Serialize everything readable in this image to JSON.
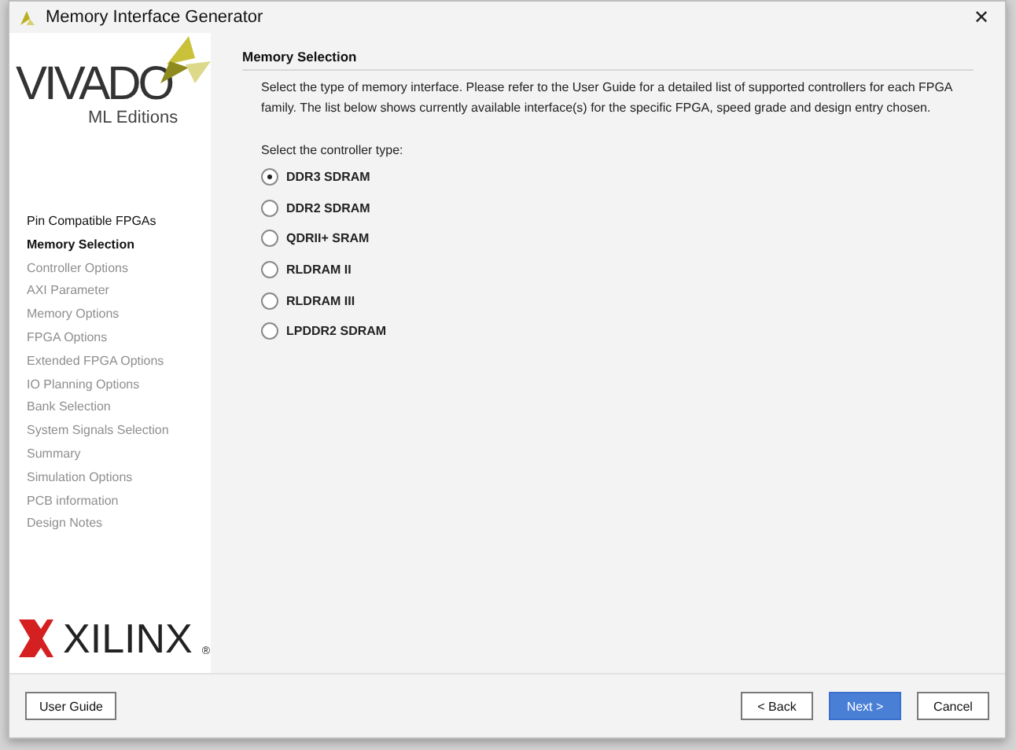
{
  "window": {
    "title": "Memory Interface Generator",
    "close": "✕"
  },
  "logo": {
    "product": "VIVADO",
    "edition": "ML Editions",
    "vendor": "XILINX",
    "registered": "®"
  },
  "steps": [
    {
      "label": "Pin Compatible FPGAs",
      "selected": false,
      "disabled": false
    },
    {
      "label": "Memory Selection",
      "selected": true,
      "disabled": false
    },
    {
      "label": "Controller Options",
      "selected": false,
      "disabled": true
    },
    {
      "label": "AXI Parameter",
      "selected": false,
      "disabled": true
    },
    {
      "label": "Memory Options",
      "selected": false,
      "disabled": true
    },
    {
      "label": "FPGA Options",
      "selected": false,
      "disabled": true
    },
    {
      "label": "Extended FPGA Options",
      "selected": false,
      "disabled": true
    },
    {
      "label": "IO Planning Options",
      "selected": false,
      "disabled": true
    },
    {
      "label": "Bank Selection",
      "selected": false,
      "disabled": true
    },
    {
      "label": "System Signals Selection",
      "selected": false,
      "disabled": true
    },
    {
      "label": "Summary",
      "selected": false,
      "disabled": true
    },
    {
      "label": "Simulation Options",
      "selected": false,
      "disabled": true
    },
    {
      "label": "PCB information",
      "selected": false,
      "disabled": true
    },
    {
      "label": "Design Notes",
      "selected": false,
      "disabled": true
    }
  ],
  "section": {
    "title": "Memory Selection",
    "description": "Select the type of memory interface. Please refer to the User Guide for a detailed list of supported controllers for each FPGA family. The list below shows currently available interface(s) for the specific FPGA, speed grade and design entry chosen.",
    "prompt": "Select the controller type:"
  },
  "controllers": [
    {
      "label": "DDR3 SDRAM",
      "selected": true
    },
    {
      "label": "DDR2 SDRAM",
      "selected": false
    },
    {
      "label": "QDRII+ SRAM",
      "selected": false
    },
    {
      "label": "RLDRAM II",
      "selected": false
    },
    {
      "label": "RLDRAM III",
      "selected": false
    },
    {
      "label": "LPDDR2 SDRAM",
      "selected": false
    }
  ],
  "buttons": {
    "help": "User Guide",
    "back": "< Back",
    "next": "Next >",
    "cancel": "Cancel"
  }
}
